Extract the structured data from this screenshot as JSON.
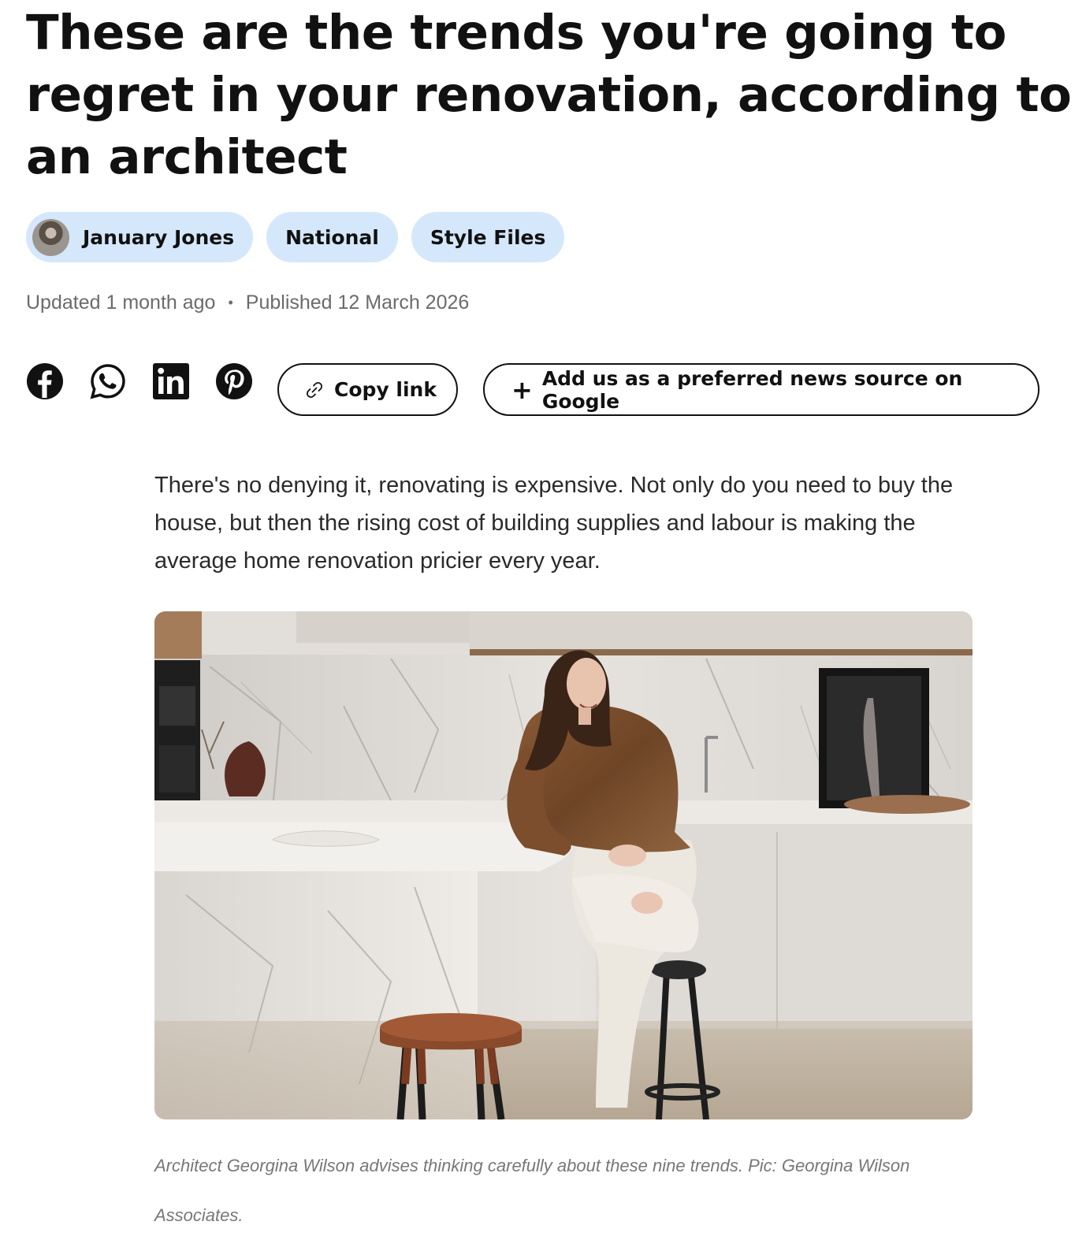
{
  "article": {
    "headline": "These are the trends you're going to regret in your renovation, according to an architect",
    "tags": [
      {
        "label": "January Jones",
        "type": "author"
      },
      {
        "label": "National",
        "type": "category"
      },
      {
        "label": "Style Files",
        "type": "category"
      }
    ],
    "updated": "Updated 1 month ago",
    "separator": "•",
    "published": "Published 12 March 2026",
    "intro": "There's no denying it, renovating is expensive. Not only do you need to buy the house, but then the rising cost of building supplies and labour is making the average home renovation pricier every year.",
    "image_caption": "Architect Georgina Wilson advises thinking carefully about these nine trends. Pic: Georgina Wilson Associates."
  },
  "share": {
    "icons": [
      "facebook-icon",
      "whatsapp-icon",
      "linkedin-icon",
      "pinterest-icon"
    ],
    "copy_link_label": "Copy link",
    "preferred_source_label": "Add us as a preferred news source on Google"
  },
  "colors": {
    "chip_bg": "#d5e7fb",
    "text": "#111111",
    "meta": "#6b6b6b",
    "caption": "#777777"
  }
}
